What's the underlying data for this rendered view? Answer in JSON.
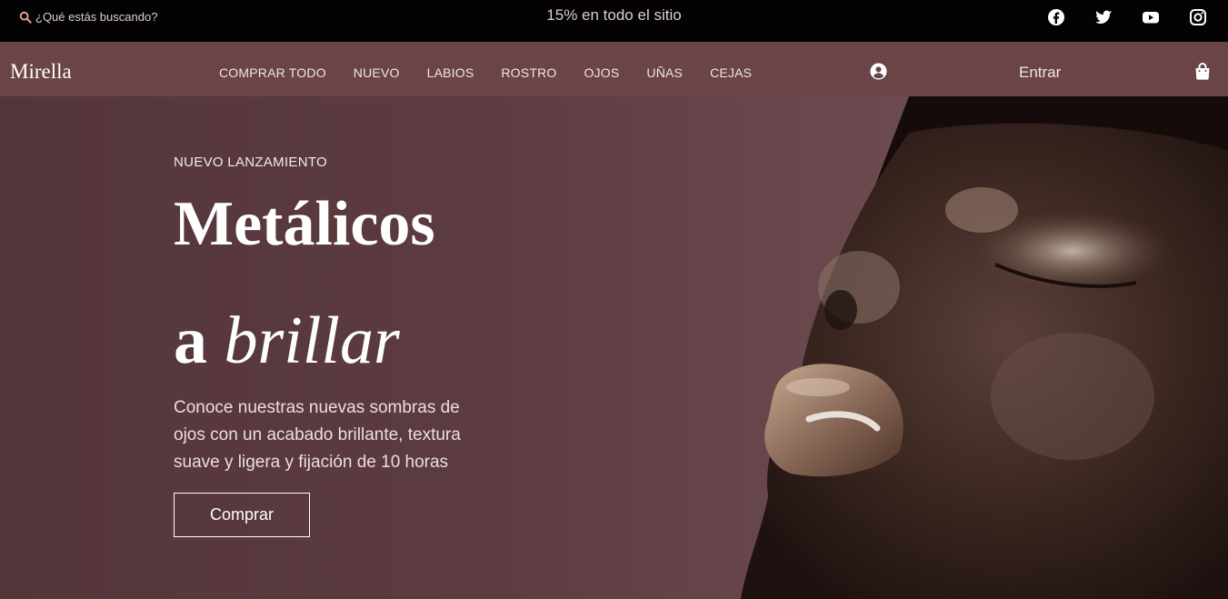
{
  "topbar": {
    "search_placeholder": "¿Qué estás buscando?",
    "promo": "15% en todo el sitio",
    "social": [
      "facebook-icon",
      "twitter-icon",
      "youtube-icon",
      "instagram-icon"
    ]
  },
  "nav": {
    "logo": "Mirella",
    "menu": [
      "COMPRAR TODO",
      "NUEVO",
      "LABIOS",
      "ROSTRO",
      "OJOS",
      "UÑAS",
      "CEJAS"
    ],
    "login": "Entrar"
  },
  "hero": {
    "eyebrow": "NUEVO LANZAMIENTO",
    "headline_line1": "Metálicos",
    "headline_line2_a": "a",
    "headline_line2_b": "brillar",
    "description": "Conoce nuestras nuevas sombras de ojos con un acabado brillante, textura suave y ligera y fijación de 10 horas",
    "cta": "Comprar"
  },
  "colors": {
    "topbar_bg": "#040203",
    "nav_bg": "#6a4447",
    "hero_bg": "#5c3c41",
    "search_icon": "#e0a09a"
  }
}
